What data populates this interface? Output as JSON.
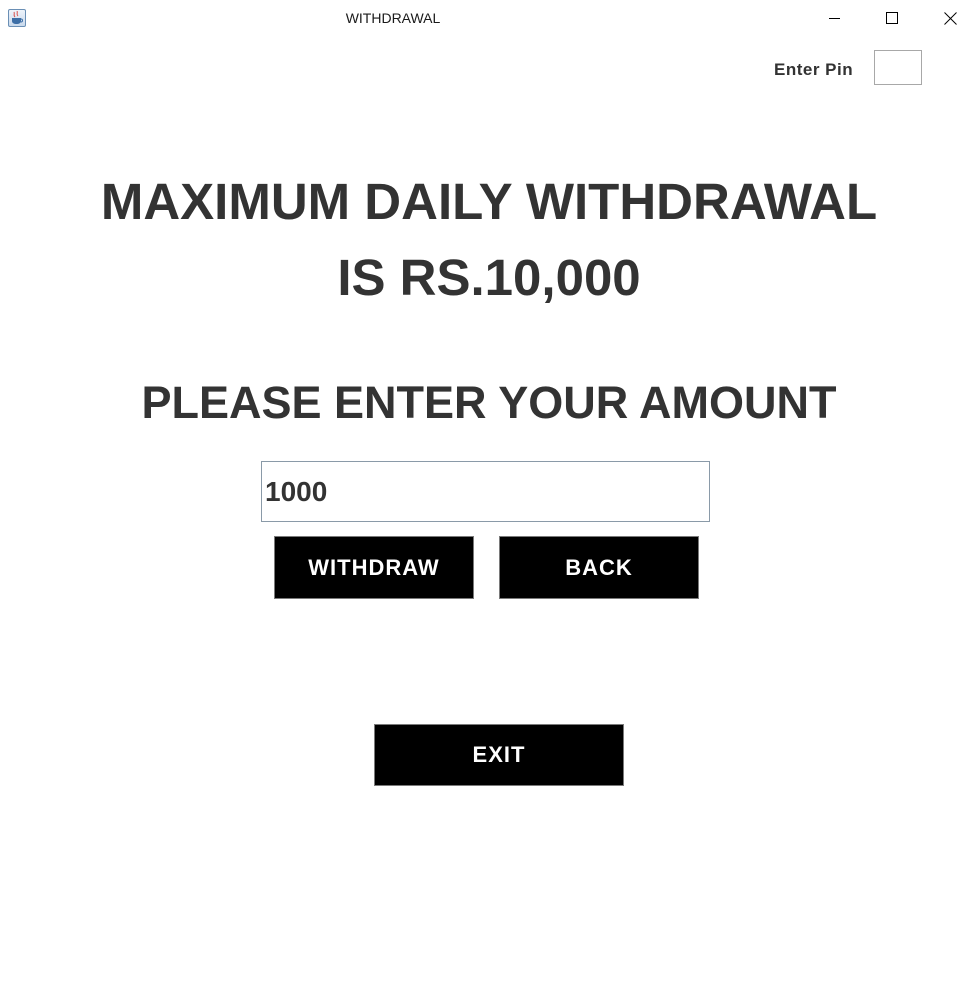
{
  "window": {
    "title": "WITHDRAWAL",
    "icon": "java-cup-icon"
  },
  "pin": {
    "label": "Enter Pin",
    "value": ""
  },
  "headings": {
    "line1": "MAXIMUM DAILY WITHDRAWAL",
    "line2": "IS RS.10,000",
    "prompt": "PLEASE ENTER YOUR AMOUNT"
  },
  "amount": {
    "value": "1000"
  },
  "buttons": {
    "withdraw": "WITHDRAW",
    "back": "BACK",
    "exit": "EXIT"
  },
  "colors": {
    "heading_text": "#333333",
    "button_bg": "#000000",
    "button_text": "#ffffff"
  }
}
